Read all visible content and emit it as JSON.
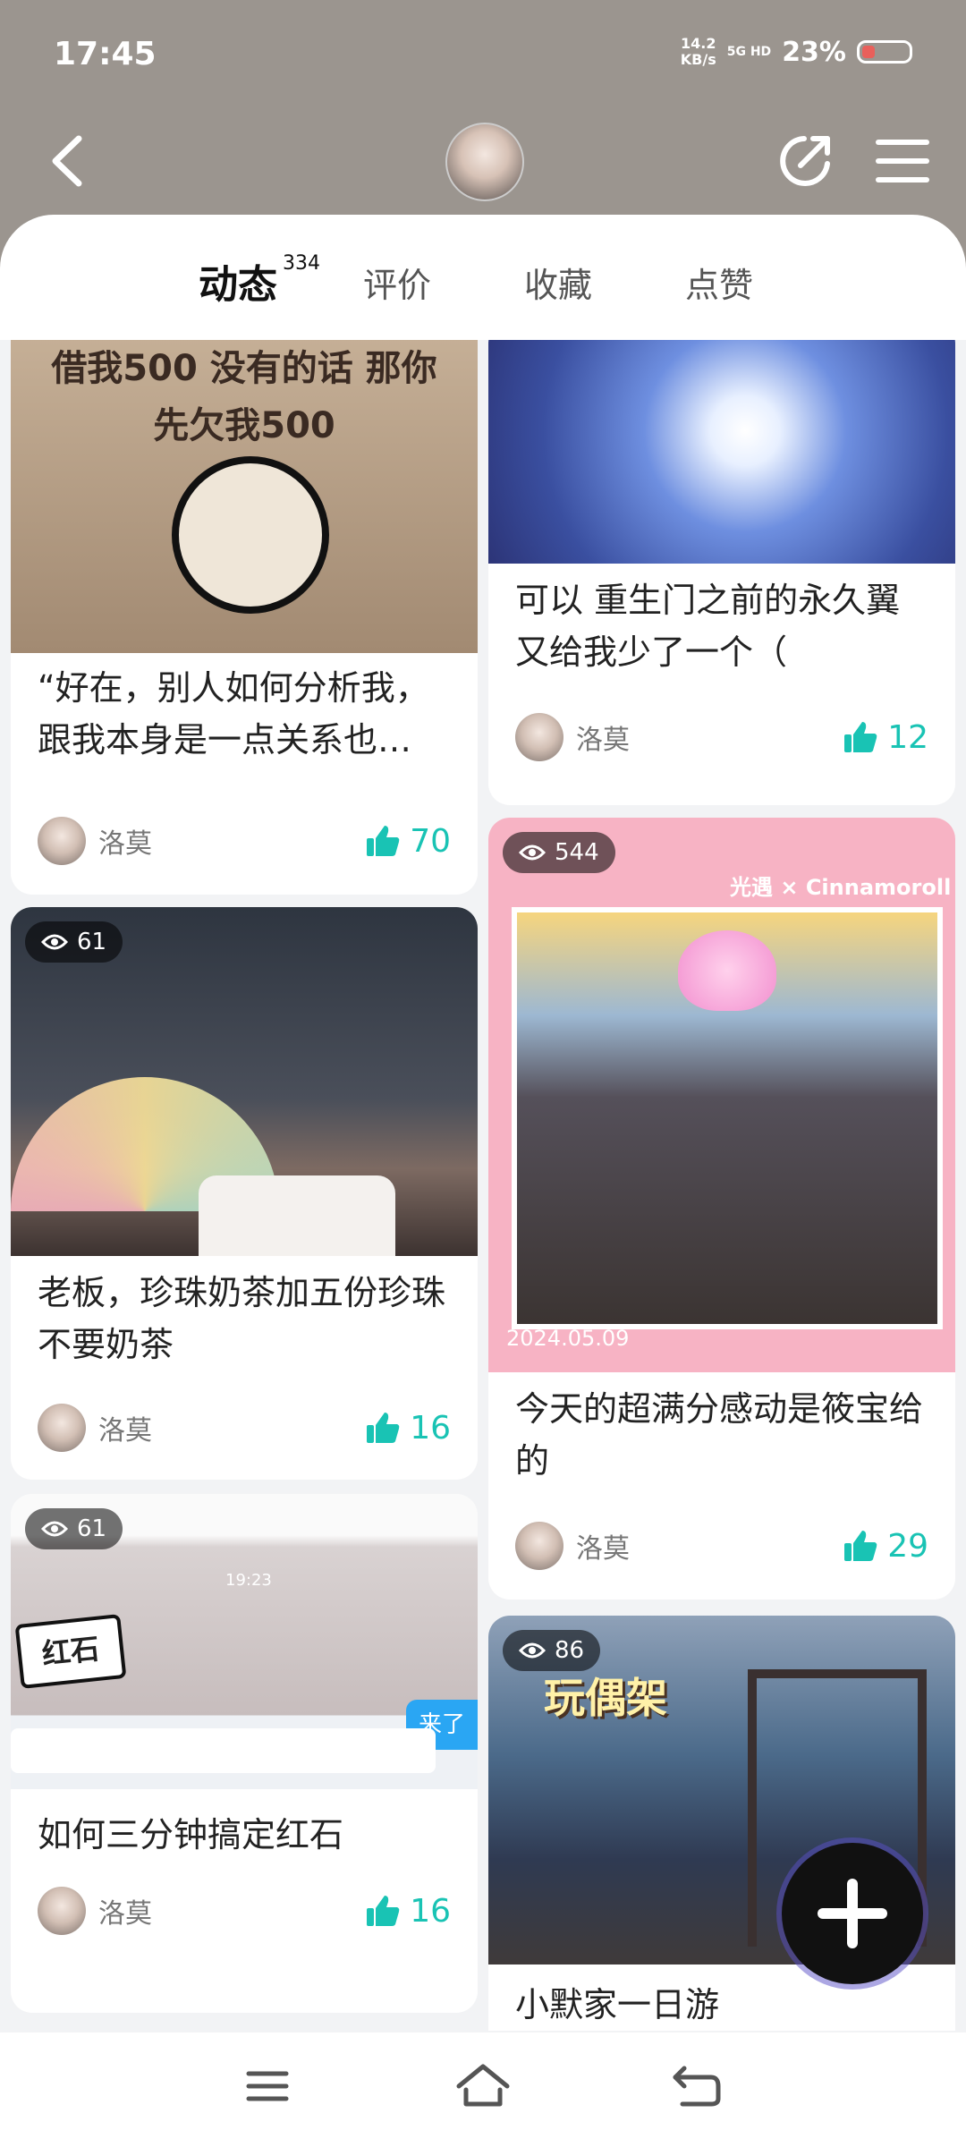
{
  "status_bar": {
    "time": "17:45",
    "net_speed_value": "14.2",
    "net_speed_unit": "KB/s",
    "signal": "5G HD",
    "battery": "23%"
  },
  "nav": {
    "back_icon": "chevron-left-icon",
    "share_icon": "share-icon",
    "menu_icon": "hamburger-menu-icon"
  },
  "tabs": [
    {
      "label": "动态",
      "count": "334",
      "active": true
    },
    {
      "label": "评价"
    },
    {
      "label": "收藏"
    },
    {
      "label": "点赞"
    }
  ],
  "posts": [
    {
      "title": "“好在，别人如何分析我，跟我本身是一点关系也…",
      "author": "洛莫",
      "likes": "70",
      "image_text": "借我500 没有的话 那你先欠我500"
    },
    {
      "title": "可以 重生门之前的永久翼又给我少了一个（",
      "author": "洛莫",
      "likes": "12"
    },
    {
      "title": "老板，珍珠奶茶加五份珍珠不要奶茶",
      "author": "洛莫",
      "likes": "16",
      "views": "61"
    },
    {
      "title": "今天的超满分感动是筱宝给的",
      "author": "洛莫",
      "likes": "29",
      "views": "544",
      "image_text": "光遇 × Cinnamoroll",
      "image_date": "2024.05.09"
    },
    {
      "title": "如何三分钟搞定红石",
      "author": "洛莫",
      "likes": "16",
      "views": "61",
      "image_text": "红石",
      "image_time": "19:23",
      "image_button": "来了"
    },
    {
      "title": "小默家一日游",
      "views": "86",
      "image_text": "玩偶架"
    }
  ],
  "colors": {
    "accent": "#19c3b4",
    "header_bg": "#9b958f",
    "tab_underline": "#2bd5c2"
  }
}
